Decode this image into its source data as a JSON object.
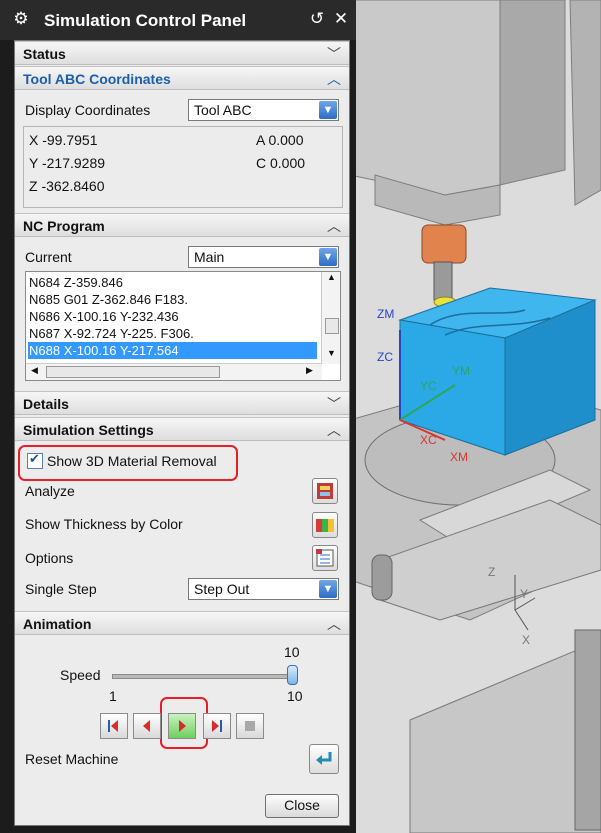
{
  "window": {
    "title": "Simulation Control Panel"
  },
  "sections": {
    "status": "Status",
    "tool_coords": "Tool ABC Coordinates",
    "nc_program": "NC Program",
    "details": "Details",
    "sim_settings": "Simulation Settings",
    "animation": "Animation"
  },
  "coords": {
    "display_label": "Display Coordinates",
    "display_value": "Tool ABC",
    "x": "X -99.7951",
    "y": "Y -217.9289",
    "z": "Z -362.8460",
    "a": "A 0.000",
    "c": "C 0.000"
  },
  "nc": {
    "current_label": "Current",
    "current_value": "Main",
    "lines": [
      "N684 Z-359.846",
      "N685 G01 Z-362.846 F183.",
      "N686 X-100.16 Y-232.436",
      "N687 X-92.724 Y-225. F306.",
      "N688 X-100.16 Y-217.564"
    ],
    "selected_index": 4
  },
  "settings": {
    "show_material_removal": "Show 3D Material Removal",
    "show_material_removal_checked": true,
    "analyze": "Analyze",
    "thickness": "Show Thickness by Color",
    "options": "Options",
    "single_step_label": "Single Step",
    "single_step_value": "Step Out"
  },
  "animation": {
    "speed_label": "Speed",
    "speed_value": "10",
    "speed_min": "1",
    "speed_max": "10",
    "speed_fraction": 1.0,
    "reset_label": "Reset Machine"
  },
  "close_label": "Close",
  "viewport_labels": {
    "zm": "ZM",
    "zc": "ZC",
    "yc": "YC",
    "ym": "YM",
    "xc": "XC",
    "xm": "XM",
    "z": "Z",
    "y": "Y",
    "x": "X"
  },
  "colors": {
    "highlight": "#e5202a",
    "workpiece": "#2aa9e6",
    "selected_row": "#3399ff",
    "section_active": "#1b5fa8"
  }
}
